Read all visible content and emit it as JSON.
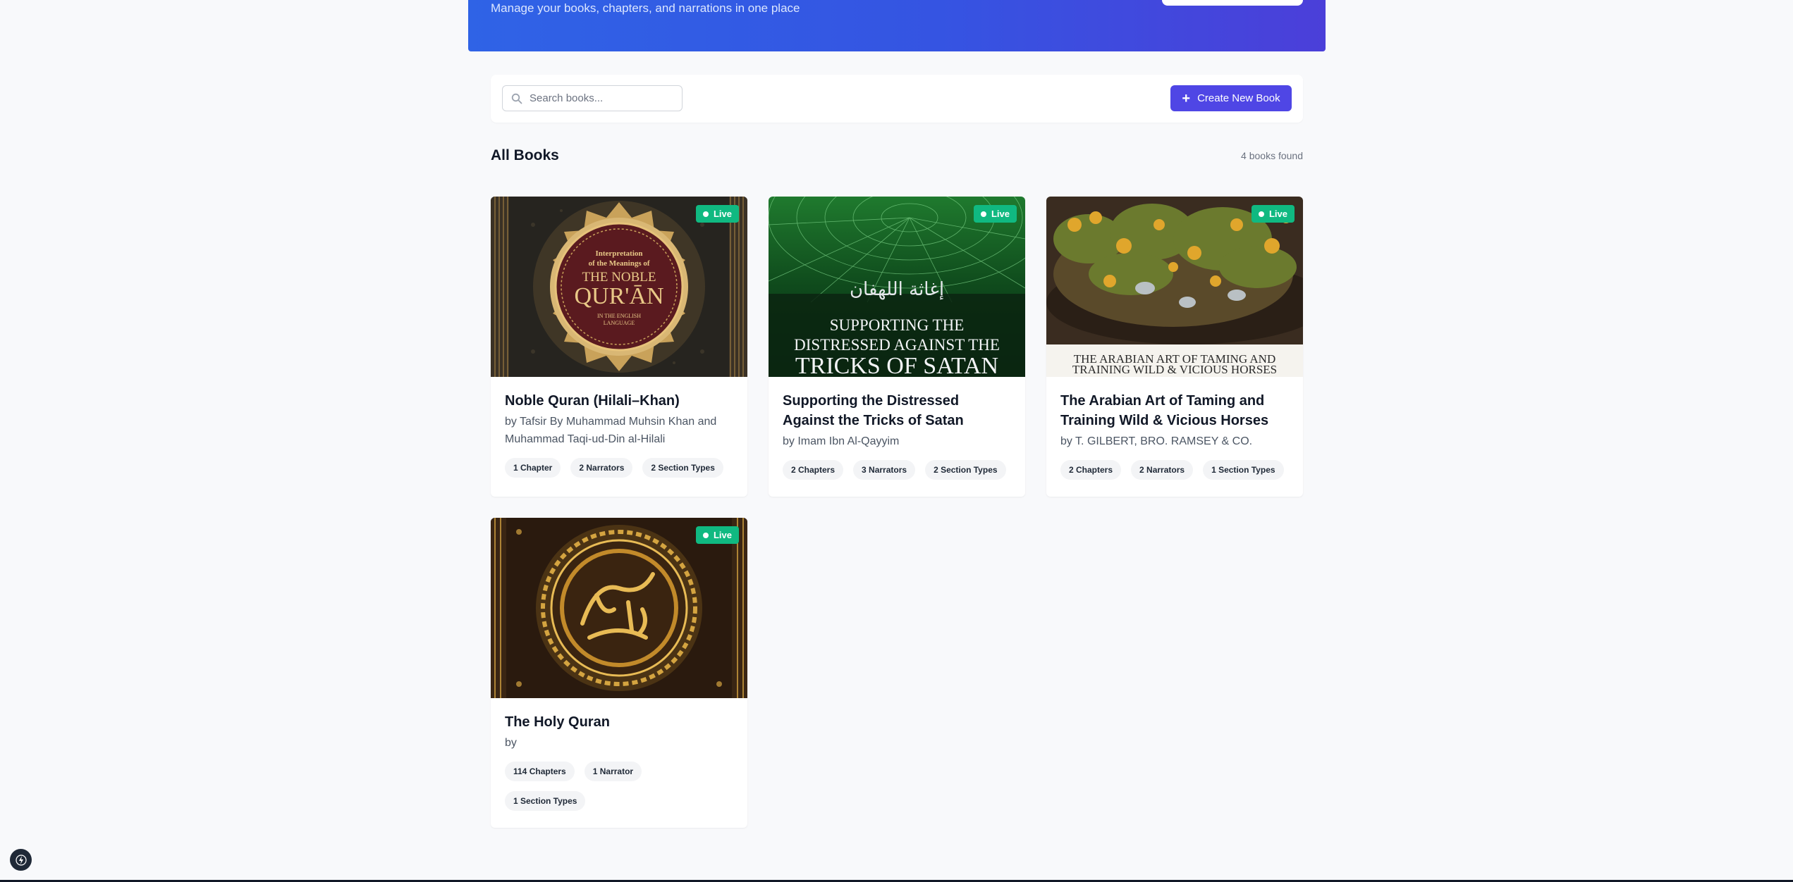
{
  "header": {
    "subtitle": "Manage your books, chapters, and narrations in one place"
  },
  "toolbar": {
    "search_placeholder": "Search books...",
    "create_label": "Create New Book"
  },
  "section": {
    "title": "All Books",
    "count": "4 books found"
  },
  "books": [
    {
      "title": "Noble Quran (Hilali–Khan)",
      "author": "by Tafsir By Muhammad Muhsin Khan and Muhammad Taqi-ud-Din al-Hilali",
      "status": "Live",
      "tags": [
        "1 Chapter",
        "2 Narrators",
        "2 Section Types"
      ],
      "cover": {
        "line1": "Interpretation",
        "line2": "of the Meanings of",
        "line3": "THE NOBLE",
        "line4": "QUR'ĀN",
        "line5": "IN THE ENGLISH",
        "line6": "LANGUAGE"
      }
    },
    {
      "title": "Supporting the Distressed Against the Tricks of Satan",
      "author": "by Imam Ibn Al-Qayyim",
      "status": "Live",
      "tags": [
        "2 Chapters",
        "3 Narrators",
        "2 Section Types"
      ],
      "cover": {
        "arabic": "إغاثة اللهفان",
        "line1": "SUPPORTING THE",
        "line2": "DISTRESSED AGAINST THE",
        "line3": "TRICKS OF SATAN"
      }
    },
    {
      "title": "The Arabian Art of Taming and Training Wild & Vicious Horses",
      "author": "by T. GILBERT, BRO. RAMSEY & CO.",
      "status": "Live",
      "tags": [
        "2 Chapters",
        "2 Narrators",
        "1 Section Types"
      ],
      "cover": {
        "line1": "THE ARABIAN ART OF TAMING AND",
        "line2": "TRAINING WILD & VICIOUS HORSES"
      }
    },
    {
      "title": "The Holy Quran",
      "author": "by",
      "status": "Live",
      "tags": [
        "114 Chapters",
        "1 Narrator",
        "1 Section Types"
      ],
      "cover": {}
    }
  ],
  "colors": {
    "primary": "#4f46e5",
    "live": "#10b981",
    "hero_start": "#2f63e6",
    "hero_end": "#4b3fd9"
  }
}
